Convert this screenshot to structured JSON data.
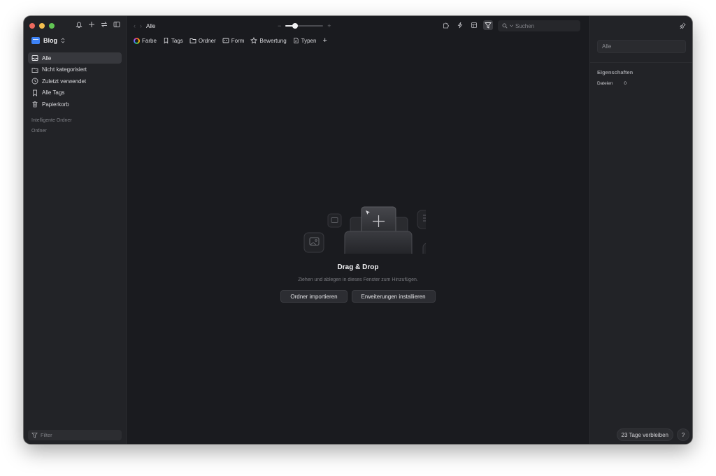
{
  "sidebar": {
    "library": "Blog",
    "items": [
      {
        "label": "Alle",
        "icon": "inbox-icon",
        "active": true
      },
      {
        "label": "Nicht kategorisiert",
        "icon": "folder-unsorted-icon"
      },
      {
        "label": "Zuletzt verwendet",
        "icon": "clock-icon"
      },
      {
        "label": "Alle Tags",
        "icon": "bookmark-icon"
      },
      {
        "label": "Papierkorb",
        "icon": "trash-icon"
      }
    ],
    "smart_folders": "Intelligente Ordner",
    "folders": "Ordner",
    "filter_placeholder": "Filter"
  },
  "toolbar": {
    "breadcrumb": "Alle",
    "zoom_minus": "−",
    "zoom_plus": "+",
    "zoom_level": 0.25,
    "search_placeholder": "Suchen"
  },
  "filters": {
    "color": "Farbe",
    "tags": "Tags",
    "folder": "Ordner",
    "shape": "Form",
    "rating": "Bewertung",
    "types": "Typen",
    "add": "+"
  },
  "empty_state": {
    "title": "Drag & Drop",
    "subtitle": "Ziehen und ablegen in dieses Fenster zum Hinzufügen.",
    "import_button": "Ordner importieren",
    "extensions_button": "Erweiterungen installieren"
  },
  "inspector": {
    "name_value": "Alle",
    "properties_heading": "Eigenschaften",
    "files_label": "Dateien",
    "files_count": "0",
    "trial": "23 Tage verbleiben",
    "help": "?"
  },
  "colors": {
    "window_bg": "#1a1b1f",
    "sidebar_bg": "#222327",
    "accent": "#3d82f6"
  }
}
